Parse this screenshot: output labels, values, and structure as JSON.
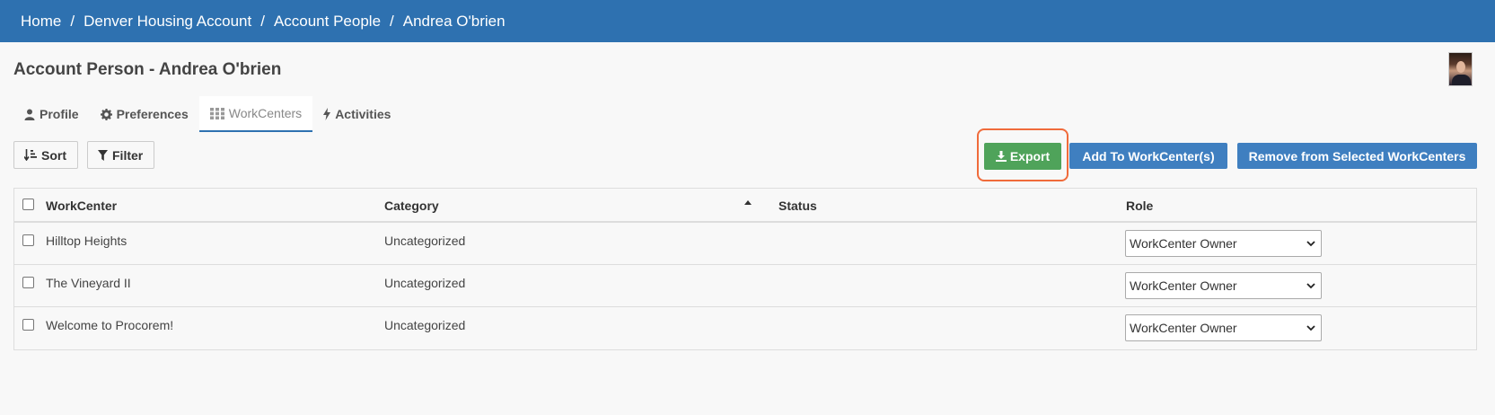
{
  "breadcrumb": [
    "Home",
    "Denver Housing Account",
    "Account People",
    "Andrea O'brien"
  ],
  "breadcrumb_separator": "/",
  "page": {
    "title": "Account Person - Andrea O'brien"
  },
  "tabs": [
    {
      "label": "Profile",
      "icon": "user-icon"
    },
    {
      "label": "Preferences",
      "icon": "gear-icon"
    },
    {
      "label": "WorkCenters",
      "icon": "grid-icon",
      "active": true
    },
    {
      "label": "Activities",
      "icon": "bolt-icon"
    }
  ],
  "toolbar": {
    "sort_label": "Sort",
    "filter_label": "Filter",
    "export_label": "Export",
    "add_label": "Add To WorkCenter(s)",
    "remove_label": "Remove from Selected WorkCenters"
  },
  "table": {
    "columns": [
      "WorkCenter",
      "Category",
      "Status",
      "Role"
    ],
    "sorted_column": "Category",
    "sort_direction": "ascending",
    "rows": [
      {
        "workcenter": "Hilltop Heights",
        "category": "Uncategorized",
        "status": "",
        "role": "WorkCenter Owner"
      },
      {
        "workcenter": "The Vineyard II",
        "category": "Uncategorized",
        "status": "",
        "role": "WorkCenter Owner"
      },
      {
        "workcenter": "Welcome to Procorem!",
        "category": "Uncategorized",
        "status": "",
        "role": "WorkCenter Owner"
      }
    ]
  },
  "colors": {
    "topbar": "#2e71b0",
    "export": "#4fa35a",
    "primary_button": "#3f7fc0",
    "highlight_ring": "#f06b3b",
    "link": "#3a7cc0"
  }
}
